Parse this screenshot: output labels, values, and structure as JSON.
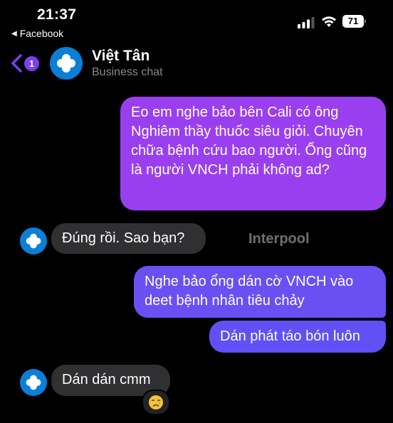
{
  "status_bar": {
    "time": "21:37",
    "back_app_label": "Facebook",
    "battery": "71"
  },
  "header": {
    "back_count": "1",
    "contact_name": "Việt Tân",
    "contact_subtitle": "Business chat",
    "accent_color": "#7b3df5"
  },
  "messages": [
    {
      "side": "outgoing",
      "text": "Eo em nghe bảo bên Cali có ông Nghiêm thầy thuốc siêu giỏi. Chuyên chữa bệnh cứu bao người. Ổng cũng là người VNCH phải không ad?"
    },
    {
      "side": "incoming",
      "text": "Đúng rồi. Sao bạn?"
    },
    {
      "side": "outgoing",
      "text": "Nghe bảo ổng dán cờ VNCH vào deet bệnh nhân tiêu chảy"
    },
    {
      "side": "outgoing",
      "text": "Dán phát táo bón luôn"
    },
    {
      "side": "incoming",
      "text": "Dán dán cmm",
      "reaction_icon": "crying-face-icon"
    }
  ],
  "watermark": "Interpool",
  "colors": {
    "background": "#000000",
    "outgoing_gradient_top": "#9a3ff0",
    "outgoing_gradient_bottom": "#6050f5",
    "incoming_bubble": "#303033",
    "avatar_blue": "#0a7fd8"
  }
}
